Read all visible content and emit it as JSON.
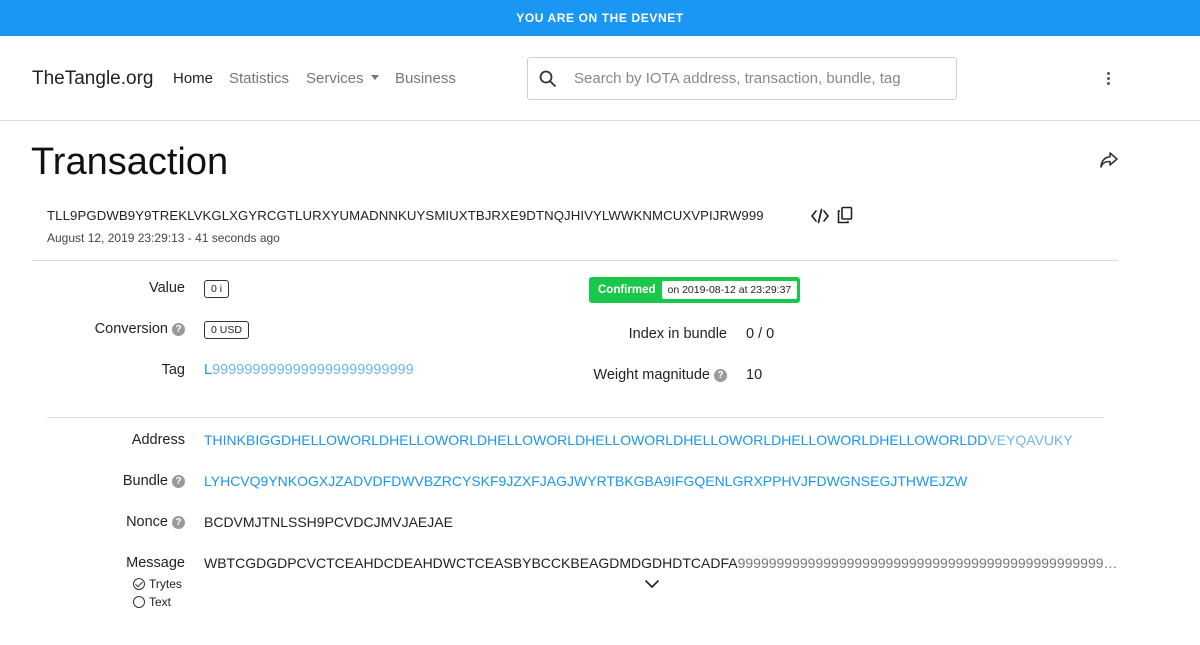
{
  "banner": {
    "text": "YOU ARE ON THE DEVNET"
  },
  "nav": {
    "brand": "TheTangle.org",
    "items": [
      {
        "label": "Home"
      },
      {
        "label": "Statistics"
      },
      {
        "label": "Services"
      },
      {
        "label": "Business"
      }
    ],
    "search_placeholder": "Search by IOTA address, transaction, bundle, tag",
    "icons": {
      "search": "search-icon",
      "menu": "kebab-menu-icon"
    }
  },
  "page": {
    "title": "Transaction",
    "hash": "TLL9PGDWB9Y9TREKLVKGLXGYRCGTLURXYUMADNNKUYSMIUXTBJRXE9DTNQJHIVYLWWKNMCUXVPIJRW999",
    "timestamp": "August 12, 2019 23:29:13 - 41 seconds ago",
    "icons": {
      "share": "share-icon",
      "code": "code-icon",
      "copy": "copy-icon"
    }
  },
  "details": {
    "value_label": "Value",
    "value": "0 i",
    "conversion_label": "Conversion",
    "conversion": "0 USD",
    "tag_label": "Tag",
    "tag_first": "L",
    "tag_rest": "9999999999999999999999999",
    "status": "Confirmed",
    "status_date": "on 2019-08-12 at 23:29:37",
    "index_label": "Index in bundle",
    "index_value": "0 / 0",
    "weight_label": "Weight magnitude",
    "weight_value": "10",
    "status_color": "#19c84a",
    "link_color": "#1a96f3"
  },
  "fields": {
    "address_label": "Address",
    "address_main": "THINKBIGGDHELLOWORLDHELLOWORLDHELLOWORLDHELLOWORLDHELLOWORLDHELLOWORLDHELLOWORLDD",
    "address_checksum": "VEYQAVUKY",
    "bundle_label": "Bundle",
    "bundle": "LYHCVQ9YNKOGXJZADVDFDWVBZRCYSKF9JZXFJAGJWYRTBKGBA9IFGQENLGRXPPHVJFDWGNSEGJTHWEJZW",
    "nonce_label": "Nonce",
    "nonce": "BCDVMJTNLSSH9PCVDCJMVJAEJAE",
    "message_label": "Message",
    "message_main": "WBTCGDGDPCVCTCEAHDCDEAHDWCTCEASBYBCCKBEAGDMDGDHDTCADFA",
    "message_padding": "99999999999999999999999999999999999999999999999…",
    "message_options": [
      {
        "label": "Trytes",
        "selected": true
      },
      {
        "label": "Text",
        "selected": false
      }
    ]
  },
  "help_glyph": "?"
}
